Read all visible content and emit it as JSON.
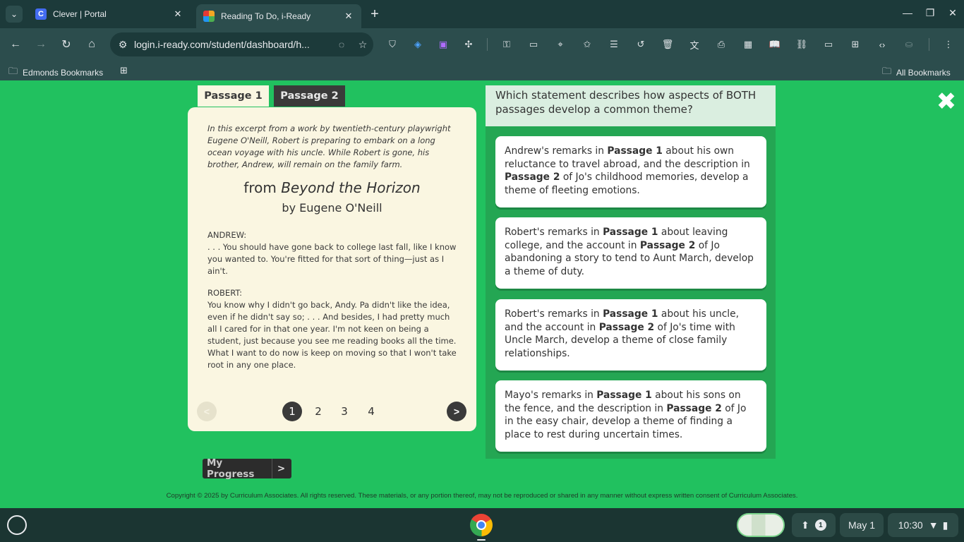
{
  "browser": {
    "tabs": [
      {
        "title": "Clever | Portal",
        "favicon": "C"
      },
      {
        "title": "Reading To Do, i-Ready"
      }
    ],
    "url": "login.i-ready.com/student/dashboard/h...",
    "bookmarks_bar": {
      "left": "Edmonds Bookmarks",
      "right": "All Bookmarks"
    }
  },
  "passage_tabs": [
    "Passage 1",
    "Passage 2"
  ],
  "passage": {
    "intro": "In this excerpt from a work by twentieth-century playwright Eugene O'Neill, Robert is preparing to embark on a long ocean voyage with his uncle. While Robert is gone, his brother, Andrew, will remain on the family farm.",
    "title_prefix": "from",
    "title_work": "Beyond the Horizon",
    "author": "by Eugene O'Neill",
    "lines": [
      {
        "speaker": "ANDREW:",
        "text": ". . . You should have gone back to college last fall, like I know you wanted to. You're fitted for that sort of thing—just as I ain't."
      },
      {
        "speaker": "ROBERT:",
        "text": "You know why I didn't go back, Andy. Pa didn't like the idea, even if he didn't say so; . . . And besides, I had pretty much all I cared for in that one year. I'm not keen on being a student, just because you see me reading books all the time. What I want to do now is keep on moving so that I won't take root in any one place."
      }
    ],
    "pager": {
      "prev": "<",
      "next": ">",
      "pages": [
        "1",
        "2",
        "3",
        "4"
      ],
      "current_page": 1
    }
  },
  "my_progress": {
    "label": "My Progress",
    "arrow": ">"
  },
  "question": {
    "text": "Which statement describes how aspects of BOTH passages develop a common theme?",
    "answers": [
      {
        "t1": "Andrew's remarks in ",
        "b1": "Passage 1",
        "t2": " about his own reluctance to travel abroad, and the description in ",
        "b2": "Passage 2",
        "t3": " of Jo's childhood memories, develop a theme of fleeting emotions."
      },
      {
        "t1": "Robert's remarks in ",
        "b1": "Passage 1",
        "t2": " about leaving college, and the account in ",
        "b2": "Passage 2",
        "t3": " of Jo abandoning a story to tend to Aunt March, develop a theme of duty."
      },
      {
        "t1": "Robert's remarks in ",
        "b1": "Passage 1",
        "t2": " about his uncle, and the account in ",
        "b2": "Passage 2",
        "t3": " of Jo's time with Uncle March, develop a theme of close family relationships."
      },
      {
        "t1": "Mayo's remarks in ",
        "b1": "Passage 1",
        "t2": " about his sons on the fence, and the description in ",
        "b2": "Passage 2",
        "t3": " of Jo in the easy chair, develop a theme of finding a place to rest during uncertain times."
      }
    ]
  },
  "copyright": "Copyright © 2025 by Curriculum Associates. All rights reserved. These materials, or any portion thereof, may not be reproduced or shared in any manner without express written consent of Curriculum Associates.",
  "shelf": {
    "notification_count": "1",
    "date": "May 1",
    "time": "10:30"
  },
  "colors": {
    "page_bg": "#21c15f",
    "question_panel": "#24a653",
    "passage_bg": "#faf6e1",
    "chrome_dark": "#1c3a3a"
  }
}
